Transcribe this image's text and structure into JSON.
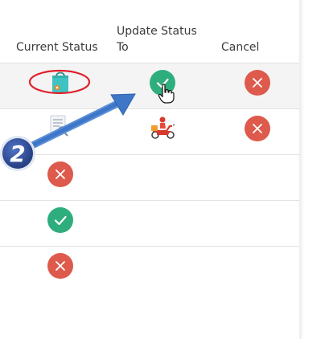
{
  "table": {
    "headers": {
      "current_status": "Current Status",
      "update_status_to": "Update Status To",
      "cancel": "Cancel"
    },
    "rows": [
      {
        "current_status_icon": "shopping-bag-icon",
        "update_icon": "check-icon",
        "cancel_icon": "close-icon",
        "selected": true
      },
      {
        "current_status_icon": "document-search-icon",
        "update_icon": "delivery-scooter-icon",
        "cancel_icon": "close-icon"
      },
      {
        "current_status_icon": "close-icon"
      },
      {
        "current_status_icon": "check-icon"
      },
      {
        "current_status_icon": "close-icon"
      }
    ]
  },
  "annotation": {
    "step_number": "2",
    "arrow_color": "#3f77c8",
    "badge_color": "#2f4f9e",
    "highlight_ellipse_color": "#e0202a"
  },
  "colors": {
    "cancel_red": "#dd5a4c",
    "confirm_green": "#2fae7d",
    "header_text": "#3b3b3b",
    "divider": "#e2e2e2",
    "selected_row_bg": "#f4f4f4"
  }
}
